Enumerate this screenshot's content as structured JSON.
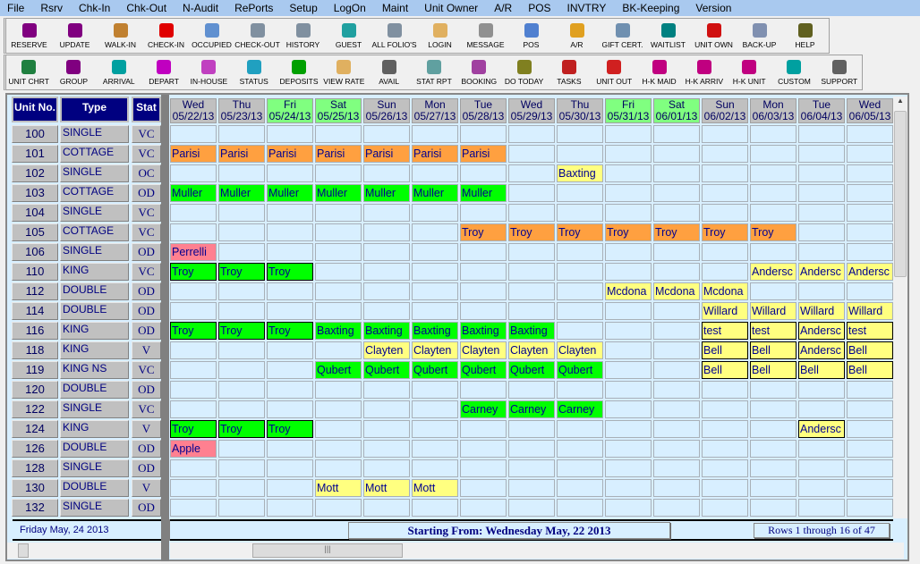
{
  "menu": [
    "File",
    "Rsrv",
    "Chk-In",
    "Chk-Out",
    "N-Audit",
    "RePorts",
    "Setup",
    "LogOn",
    "Maint",
    "Unit Owner",
    "A/R",
    "POS",
    "INVTRY",
    "BK-Keeping",
    "Version"
  ],
  "toolbar1": [
    {
      "label": "RESERVE",
      "icon": "book-icon",
      "color": "#800080"
    },
    {
      "label": "UPDATE",
      "icon": "book-icon",
      "color": "#800080"
    },
    {
      "label": "WALK-IN",
      "icon": "walk-in-icon",
      "color": "#c08030"
    },
    {
      "label": "CHECK-IN",
      "icon": "checkmark-icon",
      "color": "#e00000"
    },
    {
      "label": "OCCUPIED",
      "icon": "window-icon",
      "color": "#6090d0"
    },
    {
      "label": "CHECK-OUT",
      "icon": "folios-icon",
      "color": "#8090a0"
    },
    {
      "label": "HISTORY",
      "icon": "folios-icon",
      "color": "#8090a0"
    },
    {
      "label": "GUEST",
      "icon": "guest-icon",
      "color": "#20a0a0"
    },
    {
      "label": "ALL FOLIO'S",
      "icon": "folios-icon",
      "color": "#8090a0"
    },
    {
      "label": "LOGIN",
      "icon": "key-icon",
      "color": "#e0b060"
    },
    {
      "label": "MESSAGE",
      "icon": "message-icon",
      "color": "#909090"
    },
    {
      "label": "POS",
      "icon": "pos-icon",
      "color": "#5080d0"
    },
    {
      "label": "A/R",
      "icon": "person-icon",
      "color": "#e0a020"
    },
    {
      "label": "GIFT CERT.",
      "icon": "gift-icon",
      "color": "#7090b0"
    },
    {
      "label": "WAITLIST",
      "icon": "waitlist-icon",
      "color": "#008080"
    },
    {
      "label": "UNIT OWN",
      "icon": "unit-own-icon",
      "color": "#d01010"
    },
    {
      "label": "BACK-UP",
      "icon": "backup-icon",
      "color": "#8090b0"
    },
    {
      "label": "HELP",
      "icon": "help-book-icon",
      "color": "#606020"
    }
  ],
  "toolbar2": [
    {
      "label": "UNIT CHRT",
      "icon": "refresh-icon",
      "color": "#208040"
    },
    {
      "label": "GROUP",
      "icon": "book-icon",
      "color": "#800080"
    },
    {
      "label": "ARRIVAL",
      "icon": "car-icon",
      "color": "#00a0a0"
    },
    {
      "label": "DEPART",
      "icon": "car-icon",
      "color": "#c000c0"
    },
    {
      "label": "IN-HOUSE",
      "icon": "flowers-icon",
      "color": "#c040c0"
    },
    {
      "label": "STATUS",
      "icon": "status-icon",
      "color": "#20a0c0"
    },
    {
      "label": "DEPOSITS",
      "icon": "money-bag-icon",
      "color": "#00a000"
    },
    {
      "label": "VIEW RATE",
      "icon": "key-icon",
      "color": "#e0b060"
    },
    {
      "label": "AVAIL",
      "icon": "cup-icon",
      "color": "#606060"
    },
    {
      "label": "STAT RPT",
      "icon": "calendar-icon",
      "color": "#60a0a0"
    },
    {
      "label": "BOOKING",
      "icon": "book-icon",
      "color": "#a040a0"
    },
    {
      "label": "DO TODAY",
      "icon": "box-icon",
      "color": "#808020"
    },
    {
      "label": "TASKS",
      "icon": "tasks-icon",
      "color": "#c02020"
    },
    {
      "label": "UNIT OUT",
      "icon": "umbrella-icon",
      "color": "#d02020"
    },
    {
      "label": "H-K MAID",
      "icon": "hk-icon",
      "color": "#c00080"
    },
    {
      "label": "H-K ARRIV",
      "icon": "hk-icon",
      "color": "#c00080"
    },
    {
      "label": "H-K UNIT",
      "icon": "hk-icon",
      "color": "#c00080"
    },
    {
      "label": "CUSTOM",
      "icon": "car-icon",
      "color": "#00a0a0"
    },
    {
      "label": "SUPPORT",
      "icon": "phone-icon",
      "color": "#606060"
    }
  ],
  "headers": {
    "unit": "Unit No.",
    "type": "Type",
    "stat": "Stat"
  },
  "days": [
    {
      "dow": "Wed",
      "date": "05/22/13"
    },
    {
      "dow": "Thu",
      "date": "05/23/13"
    },
    {
      "dow": "Fri",
      "date": "05/24/13",
      "wk": true
    },
    {
      "dow": "Sat",
      "date": "05/25/13",
      "wk": true
    },
    {
      "dow": "Sun",
      "date": "05/26/13"
    },
    {
      "dow": "Mon",
      "date": "05/27/13"
    },
    {
      "dow": "Tue",
      "date": "05/28/13"
    },
    {
      "dow": "Wed",
      "date": "05/29/13"
    },
    {
      "dow": "Thu",
      "date": "05/30/13"
    },
    {
      "dow": "Fri",
      "date": "05/31/13",
      "wk": true
    },
    {
      "dow": "Sat",
      "date": "06/01/13",
      "wk": true
    },
    {
      "dow": "Sun",
      "date": "06/02/13"
    },
    {
      "dow": "Mon",
      "date": "06/03/13"
    },
    {
      "dow": "Tue",
      "date": "06/04/13"
    },
    {
      "dow": "Wed",
      "date": "06/05/13"
    }
  ],
  "colors": {
    "o": "#ffa040",
    "g": "#00ff00",
    "y": "#ffff80",
    "p": "#ff8090"
  },
  "rows": [
    {
      "unit": "100",
      "type": "SINGLE",
      "stat": "VC",
      "bookings": []
    },
    {
      "unit": "101",
      "type": "COTTAGE",
      "stat": "VC",
      "bookings": [
        {
          "name": "Parisi",
          "c": "o",
          "from": 0,
          "to": 6
        }
      ]
    },
    {
      "unit": "102",
      "type": "SINGLE",
      "stat": "OC",
      "bookings": [
        {
          "name": "Baxting",
          "c": "y",
          "from": 8,
          "to": 8
        }
      ]
    },
    {
      "unit": "103",
      "type": "COTTAGE",
      "stat": "OD",
      "bookings": [
        {
          "name": "Muller",
          "c": "g",
          "from": 0,
          "to": 6
        }
      ]
    },
    {
      "unit": "104",
      "type": "SINGLE",
      "stat": "VC",
      "bookings": []
    },
    {
      "unit": "105",
      "type": "COTTAGE",
      "stat": "VC",
      "bookings": [
        {
          "name": "Troy",
          "c": "o",
          "from": 6,
          "to": 12
        }
      ]
    },
    {
      "unit": "106",
      "type": "SINGLE",
      "stat": "OD",
      "bookings": [
        {
          "name": "Perrelli",
          "c": "p",
          "from": 0,
          "to": 0
        }
      ]
    },
    {
      "unit": "110",
      "type": "KING",
      "stat": "VC",
      "bookings": [
        {
          "name": "Troy",
          "c": "g",
          "from": 0,
          "to": 2,
          "b": true
        },
        {
          "name": "Andersc",
          "c": "y",
          "from": 12,
          "to": 14
        }
      ]
    },
    {
      "unit": "112",
      "type": "DOUBLE",
      "stat": "OD",
      "bookings": [
        {
          "name": "Mcdona",
          "c": "y",
          "from": 9,
          "to": 11
        }
      ]
    },
    {
      "unit": "114",
      "type": "DOUBLE",
      "stat": "OD",
      "bookings": [
        {
          "name": "Willard",
          "c": "y",
          "from": 11,
          "to": 14
        }
      ]
    },
    {
      "unit": "116",
      "type": "KING",
      "stat": "OD",
      "bookings": [
        {
          "name": "Troy",
          "c": "g",
          "from": 0,
          "to": 2,
          "b": true
        },
        {
          "name": "Baxting",
          "c": "g",
          "from": 3,
          "to": 7
        },
        {
          "name": "test",
          "c": "y",
          "from": 11,
          "to": 12,
          "b": true
        },
        {
          "name": "Andersc",
          "c": "y",
          "from": 13,
          "to": 13,
          "b": true
        },
        {
          "name": "test",
          "c": "y",
          "from": 14,
          "to": 14,
          "b": true
        }
      ]
    },
    {
      "unit": "118",
      "type": "KING",
      "stat": "V",
      "bookings": [
        {
          "name": "Clayten",
          "c": "y",
          "from": 4,
          "to": 8
        },
        {
          "name": "Bell",
          "c": "y",
          "from": 11,
          "to": 12,
          "b": true
        },
        {
          "name": "Andersc",
          "c": "y",
          "from": 13,
          "to": 13,
          "b": true
        },
        {
          "name": "Bell",
          "c": "y",
          "from": 14,
          "to": 14,
          "b": true
        }
      ]
    },
    {
      "unit": "119",
      "type": "KING NS",
      "stat": "VC",
      "bookings": [
        {
          "name": "Qubert",
          "c": "g",
          "from": 3,
          "to": 8
        },
        {
          "name": "Bell",
          "c": "y",
          "from": 11,
          "to": 14,
          "b": true
        }
      ]
    },
    {
      "unit": "120",
      "type": "DOUBLE",
      "stat": "OD",
      "bookings": []
    },
    {
      "unit": "122",
      "type": "SINGLE",
      "stat": "VC",
      "bookings": [
        {
          "name": "Carney",
          "c": "g",
          "from": 6,
          "to": 8
        }
      ]
    },
    {
      "unit": "124",
      "type": "KING",
      "stat": "V",
      "bookings": [
        {
          "name": "Troy",
          "c": "g",
          "from": 0,
          "to": 2,
          "b": true
        },
        {
          "name": "Andersc",
          "c": "y",
          "from": 13,
          "to": 13,
          "b": true
        }
      ]
    },
    {
      "unit": "126",
      "type": "DOUBLE",
      "stat": "OD",
      "bookings": [
        {
          "name": "Apple",
          "c": "p",
          "from": 0,
          "to": 0
        }
      ]
    },
    {
      "unit": "128",
      "type": "SINGLE",
      "stat": "OD",
      "bookings": []
    },
    {
      "unit": "130",
      "type": "DOUBLE",
      "stat": "V",
      "bookings": [
        {
          "name": "Mott",
          "c": "y",
          "from": 3,
          "to": 5
        }
      ]
    },
    {
      "unit": "132",
      "type": "SINGLE",
      "stat": "OD",
      "bookings": []
    }
  ],
  "footer": {
    "today": "Friday May, 24 2013",
    "starting": "Starting From: Wednesday May, 22 2013",
    "rows": "Rows 1 through 16 of 47"
  }
}
